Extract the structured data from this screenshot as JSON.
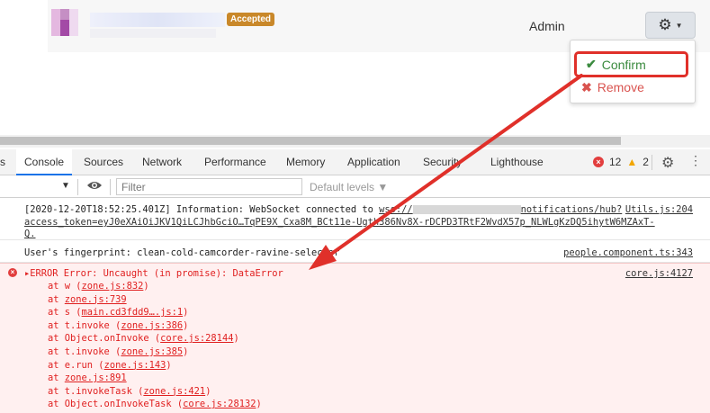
{
  "app": {
    "badge": "Accepted",
    "admin_label": "Admin",
    "menu": {
      "confirm": "Confirm",
      "remove": "Remove"
    }
  },
  "devtools": {
    "tabs": [
      "s",
      "Console",
      "Sources",
      "Network",
      "Performance",
      "Memory",
      "Application",
      "Security",
      "Lighthouse"
    ],
    "active_tab": "Console",
    "error_count": "12",
    "warning_count": "2",
    "filter_placeholder": "Filter",
    "levels_label": "Default levels ▼",
    "logs": {
      "info_line1": "[2020-12-20T18:52:25.401Z] Information: WebSocket connected to ",
      "info_url_prefix": "wss://",
      "info_url_suffix": "notifications/hub?",
      "info_source": "Utils.js:204",
      "info_line2": "access_token=eyJ0eXAiOiJKV1QiLCJhbGciO…TqPE9X_Cxa8M_BCt11e-Ugth386Nv8X-rDCPD3TRtF2WvdX57p_NLWLgKzDQ5ihytW6MZAxT-",
      "info_line3": "Q.",
      "fingerprint": "User's fingerprint: clean-cold-camcorder-ravine-selector",
      "fingerprint_source": "people.component.ts:343",
      "error_header": "ERROR Error: Uncaught (in promise): DataError",
      "error_source": "core.js:4127",
      "stack": [
        {
          "prefix": "at w (",
          "link": "zone.js:832",
          "suffix": ")"
        },
        {
          "prefix": "at ",
          "link": "zone.js:739",
          "suffix": ""
        },
        {
          "prefix": "at s (",
          "link": "main.cd3fdd9….js:1",
          "suffix": ")"
        },
        {
          "prefix": "at t.invoke (",
          "link": "zone.js:386",
          "suffix": ")"
        },
        {
          "prefix": "at Object.onInvoke (",
          "link": "core.js:28144",
          "suffix": ")"
        },
        {
          "prefix": "at t.invoke (",
          "link": "zone.js:385",
          "suffix": ")"
        },
        {
          "prefix": "at e.run (",
          "link": "zone.js:143",
          "suffix": ")"
        },
        {
          "prefix": "at ",
          "link": "zone.js:891",
          "suffix": ""
        },
        {
          "prefix": "at t.invokeTask (",
          "link": "zone.js:421",
          "suffix": ")"
        },
        {
          "prefix": "at Object.onInvokeTask (",
          "link": "core.js:28132",
          "suffix": ")"
        }
      ]
    }
  },
  "colors": {
    "annotation_red": "#e0302a",
    "confirm_green": "#3a8a3e",
    "remove_red": "#d9534f",
    "badge_orange": "#c9882a"
  }
}
